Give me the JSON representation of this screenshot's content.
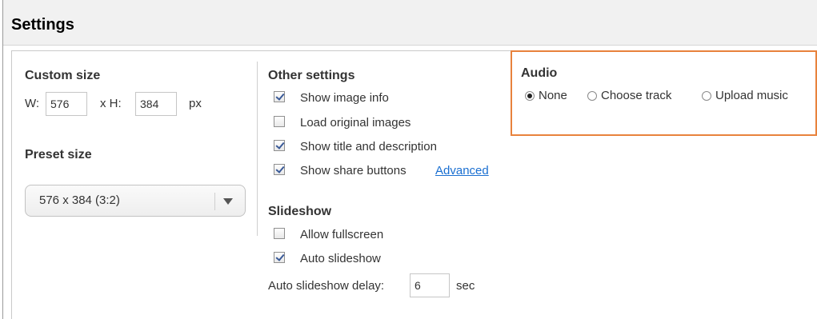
{
  "header": {
    "title": "Settings"
  },
  "custom_size": {
    "label": "Custom size",
    "width_label": "W:",
    "width_value": "576",
    "height_label": "x  H:",
    "height_value": "384",
    "unit": "px"
  },
  "preset_size": {
    "label": "Preset size",
    "selected": "576 x 384 (3:2)"
  },
  "other_settings": {
    "label": "Other settings",
    "items": [
      {
        "label": "Show image info",
        "checked": true
      },
      {
        "label": "Load original images",
        "checked": false
      },
      {
        "label": "Show title and description",
        "checked": true
      },
      {
        "label": "Show share buttons",
        "checked": true
      }
    ],
    "advanced_link": "Advanced"
  },
  "slideshow": {
    "label": "Slideshow",
    "items": [
      {
        "label": "Allow fullscreen",
        "checked": false
      },
      {
        "label": "Auto slideshow",
        "checked": true
      }
    ],
    "delay_label": "Auto slideshow delay:",
    "delay_value": "6",
    "delay_unit": "sec"
  },
  "audio": {
    "label": "Audio",
    "options": [
      {
        "label": "None",
        "selected": true
      },
      {
        "label": "Choose track",
        "selected": false
      },
      {
        "label": "Upload music",
        "selected": false
      }
    ],
    "highlight_color": "#e8823c"
  },
  "colors": {
    "link": "#1a6fd1",
    "header_bg": "#f1f1f1"
  }
}
